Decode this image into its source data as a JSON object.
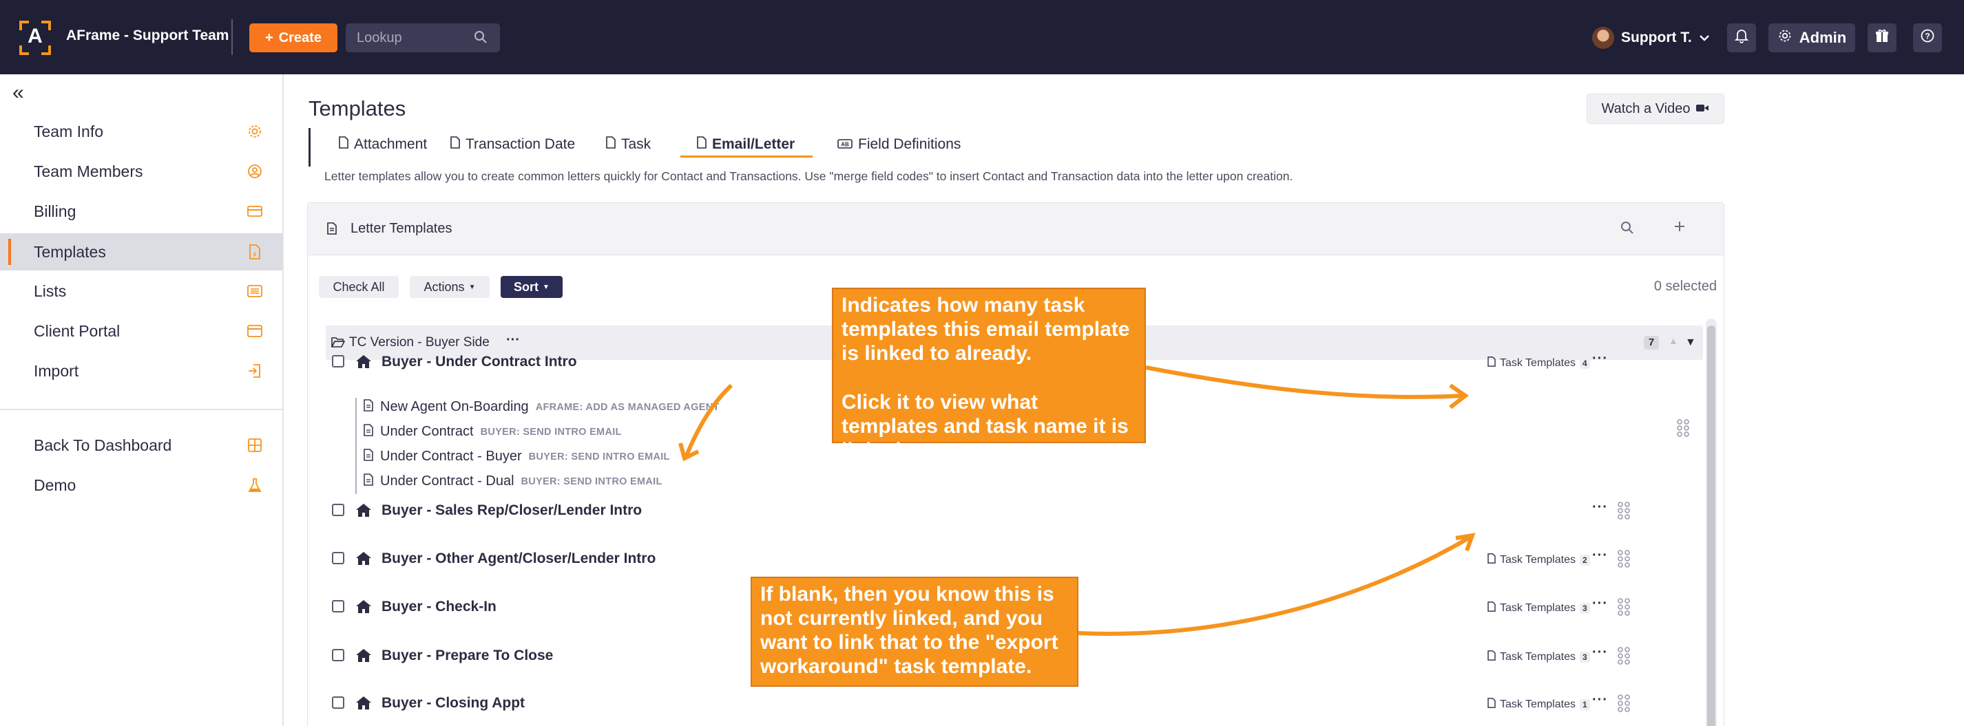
{
  "app": {
    "logo_letter": "A",
    "title": "AFrame - Support Team"
  },
  "topbar": {
    "create_label": "Create",
    "lookup_placeholder": "Lookup",
    "user_name": "Support T.",
    "admin_label": "Admin"
  },
  "sidebar": {
    "items": [
      {
        "label": "Team Info",
        "icon": "gear-icon"
      },
      {
        "label": "Team Members",
        "icon": "user-circle-icon"
      },
      {
        "label": "Billing",
        "icon": "credit-card-icon"
      },
      {
        "label": "Templates",
        "icon": "document-icon",
        "active": true
      },
      {
        "label": "Lists",
        "icon": "list-icon"
      },
      {
        "label": "Client Portal",
        "icon": "browser-window-icon"
      },
      {
        "label": "Import",
        "icon": "import-icon"
      },
      {
        "label": "Back To Dashboard",
        "icon": "dashboard-grid-icon"
      },
      {
        "label": "Demo",
        "icon": "flask-icon"
      }
    ]
  },
  "main": {
    "title": "Templates",
    "watch_video_label": "Watch a Video",
    "tabs": [
      {
        "label": "Attachment",
        "icon": "paperclip-doc-icon"
      },
      {
        "label": "Transaction Date",
        "icon": "calendar-doc-icon"
      },
      {
        "label": "Task",
        "icon": "task-doc-icon"
      },
      {
        "label": "Email/Letter",
        "icon": "letter-doc-icon",
        "active": true
      },
      {
        "label": "Field Definitions",
        "icon": "field-icon"
      }
    ],
    "description": "Letter templates allow you to create common letters quickly for Contact and Transactions. Use \"merge field codes\" to insert Contact and Transaction data into the letter upon creation."
  },
  "panel": {
    "title": "Letter Templates",
    "check_all_label": "Check All",
    "actions_label": "Actions",
    "sort_label": "Sort",
    "selected_text": "0 selected",
    "group": {
      "title": "TC Version - Buyer Side",
      "count": "7"
    },
    "task_templates_label": "Task Templates",
    "rows": [
      {
        "name": "Buyer - Under Contract Intro",
        "task_count": "4"
      },
      {
        "name": "Buyer - Sales Rep/Closer/Lender Intro",
        "task_count": ""
      },
      {
        "name": "Buyer - Other Agent/Closer/Lender Intro",
        "task_count": "2"
      },
      {
        "name": "Buyer - Check-In",
        "task_count": "3"
      },
      {
        "name": "Buyer - Prepare To Close",
        "task_count": "3"
      },
      {
        "name": "Buyer - Closing Appt",
        "task_count": "1"
      }
    ],
    "linked_tasks": [
      {
        "name": "New Agent On-Boarding",
        "tag": "AFRAME: ADD AS MANAGED AGENT"
      },
      {
        "name": "Under Contract",
        "tag": "BUYER: SEND INTRO EMAIL"
      },
      {
        "name": "Under Contract - Buyer",
        "tag": "BUYER: SEND INTRO EMAIL"
      },
      {
        "name": "Under Contract - Dual",
        "tag": "BUYER: SEND INTRO EMAIL"
      }
    ]
  },
  "annotations": {
    "note1_line1": "Indicates how many task templates this email template is linked to already.",
    "note1_line2": "Click it to view what templates and task name it is linked to.",
    "note2": "If blank, then you know this is not currently linked, and you want to link that to the \"export workaround\" task template."
  },
  "colors": {
    "accent": "#f7761e",
    "topbar": "#1f1f35",
    "annotation": "#f7941d"
  }
}
